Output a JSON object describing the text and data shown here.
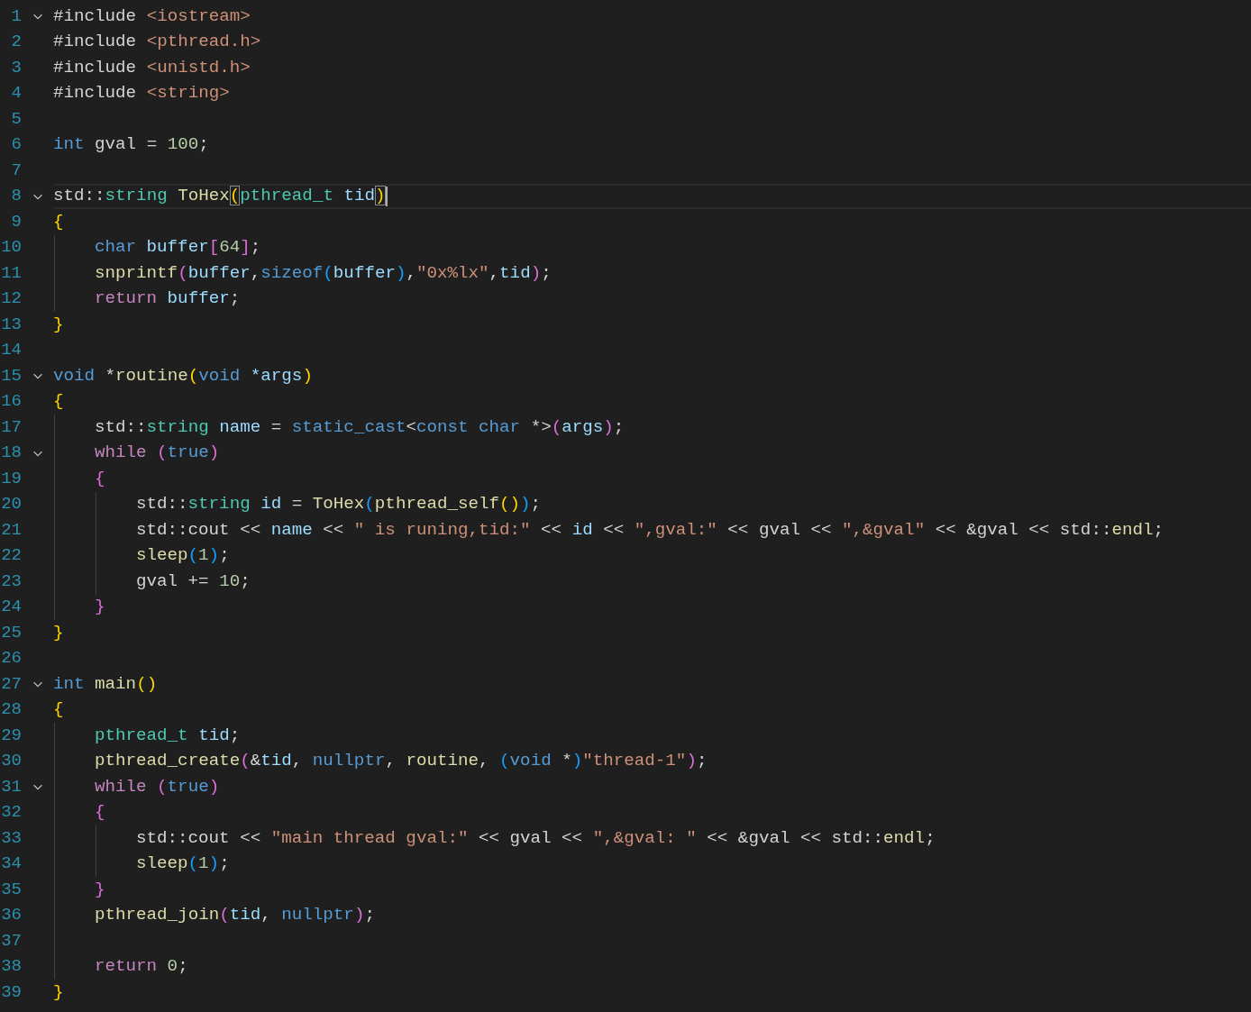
{
  "editor": {
    "lines": [
      {
        "number": "1",
        "kind": "top",
        "expanded": true,
        "current": false,
        "tokens": [
          {
            "kind": "plain",
            "text": "#include "
          },
          {
            "kind": "string",
            "text": "<iostream>"
          }
        ]
      },
      {
        "number": "2",
        "kind": "top",
        "current": false,
        "tokens": [
          {
            "kind": "plain",
            "text": "#include "
          },
          {
            "kind": "string",
            "text": "<pthread.h>"
          }
        ]
      },
      {
        "number": "3",
        "kind": "top",
        "current": false,
        "tokens": [
          {
            "kind": "plain",
            "text": "#include "
          },
          {
            "kind": "string",
            "text": "<unistd.h>"
          }
        ]
      },
      {
        "number": "4",
        "kind": "top",
        "current": false,
        "tokens": [
          {
            "kind": "plain",
            "text": "#include "
          },
          {
            "kind": "string",
            "text": "<string>"
          }
        ]
      },
      {
        "number": "5",
        "kind": "top",
        "current": false
      },
      {
        "number": "6",
        "kind": "top",
        "current": false,
        "tokens": [
          {
            "kind": "keyword",
            "text": "int"
          },
          {
            "kind": "plain",
            "text": " gval = "
          },
          {
            "kind": "number",
            "text": "100"
          },
          {
            "kind": "plain",
            "text": ";"
          }
        ]
      },
      {
        "number": "7",
        "kind": "top",
        "current": false
      },
      {
        "number": "8",
        "kind": "top",
        "expanded": true,
        "current": true,
        "tokens": [
          {
            "kind": "plain",
            "text": "std::"
          },
          {
            "kind": "type",
            "text": "string"
          },
          {
            "kind": "func",
            "text": " ToHex"
          },
          {
            "kind": "b1match",
            "text": "("
          },
          {
            "kind": "type",
            "text": "pthread_t"
          },
          {
            "kind": "param",
            "text": " tid"
          },
          {
            "kind": "b1match",
            "text": ")"
          }
        ]
      },
      {
        "number": "9",
        "kind": "top",
        "current": false,
        "tokens": [
          {
            "kind": "b1",
            "text": "{"
          }
        ]
      },
      {
        "number": "10",
        "kind": "nested",
        "current": false,
        "tokens": [
          {
            "kind": "keyword",
            "text": "char"
          },
          {
            "kind": "var",
            "text": " buffer"
          },
          {
            "kind": "b2",
            "text": "["
          },
          {
            "kind": "number",
            "text": "64"
          },
          {
            "kind": "b2",
            "text": "]"
          },
          {
            "kind": "plain",
            "text": ";"
          }
        ]
      },
      {
        "number": "11",
        "kind": "nested",
        "current": false,
        "tokens": [
          {
            "kind": "func",
            "text": "snprintf"
          },
          {
            "kind": "b2",
            "text": "("
          },
          {
            "kind": "var",
            "text": "buffer"
          },
          {
            "kind": "plain",
            "text": ","
          },
          {
            "kind": "keyword",
            "text": "sizeof"
          },
          {
            "kind": "b3",
            "text": "("
          },
          {
            "kind": "var",
            "text": "buffer"
          },
          {
            "kind": "b3",
            "text": ")"
          },
          {
            "kind": "plain",
            "text": ","
          },
          {
            "kind": "string",
            "text": "\"0x%lx\""
          },
          {
            "kind": "plain",
            "text": ","
          },
          {
            "kind": "param",
            "text": "tid"
          },
          {
            "kind": "b2",
            "text": ")"
          },
          {
            "kind": "plain",
            "text": ";"
          }
        ]
      },
      {
        "number": "12",
        "kind": "nested",
        "current": false,
        "tokens": [
          {
            "kind": "control",
            "text": "return"
          },
          {
            "kind": "var",
            "text": " buffer"
          },
          {
            "kind": "plain",
            "text": ";"
          }
        ]
      },
      {
        "number": "13",
        "kind": "top",
        "current": false,
        "tokens": [
          {
            "kind": "b1",
            "text": "}"
          }
        ]
      },
      {
        "number": "14",
        "kind": "top",
        "current": false
      },
      {
        "number": "15",
        "kind": "top",
        "expanded": true,
        "current": false,
        "tokens": [
          {
            "kind": "keyword",
            "text": "void"
          },
          {
            "kind": "plain",
            "text": " *"
          },
          {
            "kind": "func",
            "text": "routine"
          },
          {
            "kind": "b1",
            "text": "("
          },
          {
            "kind": "keyword",
            "text": "void"
          },
          {
            "kind": "param",
            "text": " *args"
          },
          {
            "kind": "b1",
            "text": ")"
          }
        ]
      },
      {
        "number": "16",
        "kind": "top",
        "current": false,
        "tokens": [
          {
            "kind": "b1",
            "text": "{"
          }
        ]
      },
      {
        "number": "17",
        "kind": "nested",
        "current": false,
        "tokens": [
          {
            "kind": "plain",
            "text": "std::"
          },
          {
            "kind": "type",
            "text": "string"
          },
          {
            "kind": "var",
            "text": " name"
          },
          {
            "kind": "plain",
            "text": " = "
          },
          {
            "kind": "keyword",
            "text": "static_cast"
          },
          {
            "kind": "plain",
            "text": "<"
          },
          {
            "kind": "keyword",
            "text": "const char"
          },
          {
            "kind": "plain",
            "text": " *>"
          },
          {
            "kind": "b2",
            "text": "("
          },
          {
            "kind": "param",
            "text": "args"
          },
          {
            "kind": "b2",
            "text": ")"
          },
          {
            "kind": "plain",
            "text": ";"
          }
        ]
      },
      {
        "number": "18",
        "kind": "nested",
        "expanded": true,
        "current": false,
        "tokens": [
          {
            "kind": "control",
            "text": "while"
          },
          {
            "kind": "b2",
            "text": " ("
          },
          {
            "kind": "keyword",
            "text": "true"
          },
          {
            "kind": "b2",
            "text": ")"
          }
        ]
      },
      {
        "number": "19",
        "kind": "nested",
        "current": false,
        "tokens": [
          {
            "kind": "b2",
            "text": "{"
          }
        ]
      },
      {
        "number": "20",
        "kind": "double-nested",
        "current": false,
        "tokens": [
          {
            "kind": "plain",
            "text": "std::"
          },
          {
            "kind": "type",
            "text": "string"
          },
          {
            "kind": "var",
            "text": " id"
          },
          {
            "kind": "plain",
            "text": " = "
          },
          {
            "kind": "func",
            "text": "ToHex"
          },
          {
            "kind": "b3",
            "text": "("
          },
          {
            "kind": "func",
            "text": "pthread_self"
          },
          {
            "kind": "b1",
            "text": "()"
          },
          {
            "kind": "b3",
            "text": ")"
          },
          {
            "kind": "plain",
            "text": ";"
          }
        ]
      },
      {
        "number": "21",
        "kind": "double-nested",
        "current": false,
        "tokens": [
          {
            "kind": "plain",
            "text": "std::cout << "
          },
          {
            "kind": "var",
            "text": "name"
          },
          {
            "kind": "plain",
            "text": " << "
          },
          {
            "kind": "string",
            "text": "\" is runing,tid:\""
          },
          {
            "kind": "plain",
            "text": " << "
          },
          {
            "kind": "var",
            "text": "id"
          },
          {
            "kind": "plain",
            "text": " << "
          },
          {
            "kind": "string",
            "text": "\",gval:\""
          },
          {
            "kind": "plain",
            "text": " << gval << "
          },
          {
            "kind": "string",
            "text": "\",&gval\""
          },
          {
            "kind": "plain",
            "text": " << &gval << std::"
          },
          {
            "kind": "func",
            "text": "endl"
          },
          {
            "kind": "plain",
            "text": ";"
          }
        ]
      },
      {
        "number": "22",
        "kind": "double-nested",
        "current": false,
        "tokens": [
          {
            "kind": "func",
            "text": "sleep"
          },
          {
            "kind": "b3",
            "text": "("
          },
          {
            "kind": "number",
            "text": "1"
          },
          {
            "kind": "b3",
            "text": ")"
          },
          {
            "kind": "plain",
            "text": ";"
          }
        ]
      },
      {
        "number": "23",
        "kind": "double-nested",
        "current": false,
        "tokens": [
          {
            "kind": "plain",
            "text": "gval += "
          },
          {
            "kind": "number",
            "text": "10"
          },
          {
            "kind": "plain",
            "text": ";"
          }
        ]
      },
      {
        "number": "24",
        "kind": "nested",
        "current": false,
        "tokens": [
          {
            "kind": "b2",
            "text": "}"
          }
        ]
      },
      {
        "number": "25",
        "kind": "top",
        "current": false,
        "tokens": [
          {
            "kind": "b1",
            "text": "}"
          }
        ]
      },
      {
        "number": "26",
        "kind": "top",
        "current": false
      },
      {
        "number": "27",
        "kind": "top",
        "expanded": true,
        "current": false,
        "tokens": [
          {
            "kind": "keyword",
            "text": "int"
          },
          {
            "kind": "func",
            "text": " main"
          },
          {
            "kind": "b1",
            "text": "()"
          }
        ]
      },
      {
        "number": "28",
        "kind": "top",
        "current": false,
        "tokens": [
          {
            "kind": "b1",
            "text": "{"
          }
        ]
      },
      {
        "number": "29",
        "kind": "nested",
        "current": false,
        "tokens": [
          {
            "kind": "type",
            "text": "pthread_t"
          },
          {
            "kind": "var",
            "text": " tid"
          },
          {
            "kind": "plain",
            "text": ";"
          }
        ]
      },
      {
        "number": "30",
        "kind": "nested",
        "current": false,
        "tokens": [
          {
            "kind": "func",
            "text": "pthread_create"
          },
          {
            "kind": "b2",
            "text": "("
          },
          {
            "kind": "plain",
            "text": "&"
          },
          {
            "kind": "var",
            "text": "tid"
          },
          {
            "kind": "plain",
            "text": ", "
          },
          {
            "kind": "keyword",
            "text": "nullptr"
          },
          {
            "kind": "plain",
            "text": ", "
          },
          {
            "kind": "func",
            "text": "routine"
          },
          {
            "kind": "plain",
            "text": ", "
          },
          {
            "kind": "b3",
            "text": "("
          },
          {
            "kind": "keyword",
            "text": "void"
          },
          {
            "kind": "plain",
            "text": " *"
          },
          {
            "kind": "b3",
            "text": ")"
          },
          {
            "kind": "string",
            "text": "\"thread-1\""
          },
          {
            "kind": "b2",
            "text": ")"
          },
          {
            "kind": "plain",
            "text": ";"
          }
        ]
      },
      {
        "number": "31",
        "kind": "nested",
        "expanded": true,
        "current": false,
        "tokens": [
          {
            "kind": "control",
            "text": "while"
          },
          {
            "kind": "b2",
            "text": " ("
          },
          {
            "kind": "keyword",
            "text": "true"
          },
          {
            "kind": "b2",
            "text": ")"
          }
        ]
      },
      {
        "number": "32",
        "kind": "nested",
        "current": false,
        "tokens": [
          {
            "kind": "b2",
            "text": "{"
          }
        ]
      },
      {
        "number": "33",
        "kind": "double-nested",
        "current": false,
        "tokens": [
          {
            "kind": "plain",
            "text": "std::cout << "
          },
          {
            "kind": "string",
            "text": "\"main thread gval:\""
          },
          {
            "kind": "plain",
            "text": " << gval << "
          },
          {
            "kind": "string",
            "text": "\",&gval: \""
          },
          {
            "kind": "plain",
            "text": " << &gval << std::"
          },
          {
            "kind": "func",
            "text": "endl"
          },
          {
            "kind": "plain",
            "text": ";"
          }
        ]
      },
      {
        "number": "34",
        "kind": "double-nested",
        "current": false,
        "tokens": [
          {
            "kind": "func",
            "text": "sleep"
          },
          {
            "kind": "b3",
            "text": "("
          },
          {
            "kind": "number",
            "text": "1"
          },
          {
            "kind": "b3",
            "text": ")"
          },
          {
            "kind": "plain",
            "text": ";"
          }
        ]
      },
      {
        "number": "35",
        "kind": "nested",
        "current": false,
        "tokens": [
          {
            "kind": "b2",
            "text": "}"
          }
        ]
      },
      {
        "number": "36",
        "kind": "nested",
        "current": false,
        "tokens": [
          {
            "kind": "func",
            "text": "pthread_join"
          },
          {
            "kind": "b2",
            "text": "("
          },
          {
            "kind": "var",
            "text": "tid"
          },
          {
            "kind": "plain",
            "text": ", "
          },
          {
            "kind": "keyword",
            "text": "nullptr"
          },
          {
            "kind": "b2",
            "text": ")"
          },
          {
            "kind": "plain",
            "text": ";"
          }
        ]
      },
      {
        "number": "37",
        "kind": "nested",
        "current": false
      },
      {
        "number": "38",
        "kind": "nested",
        "current": false,
        "tokens": [
          {
            "kind": "control",
            "text": "return "
          },
          {
            "kind": "number",
            "text": "0"
          },
          {
            "kind": "plain",
            "text": ";"
          }
        ]
      },
      {
        "number": "39",
        "kind": "top",
        "current": false,
        "tokens": [
          {
            "kind": "b1",
            "text": "}"
          }
        ]
      }
    ]
  }
}
